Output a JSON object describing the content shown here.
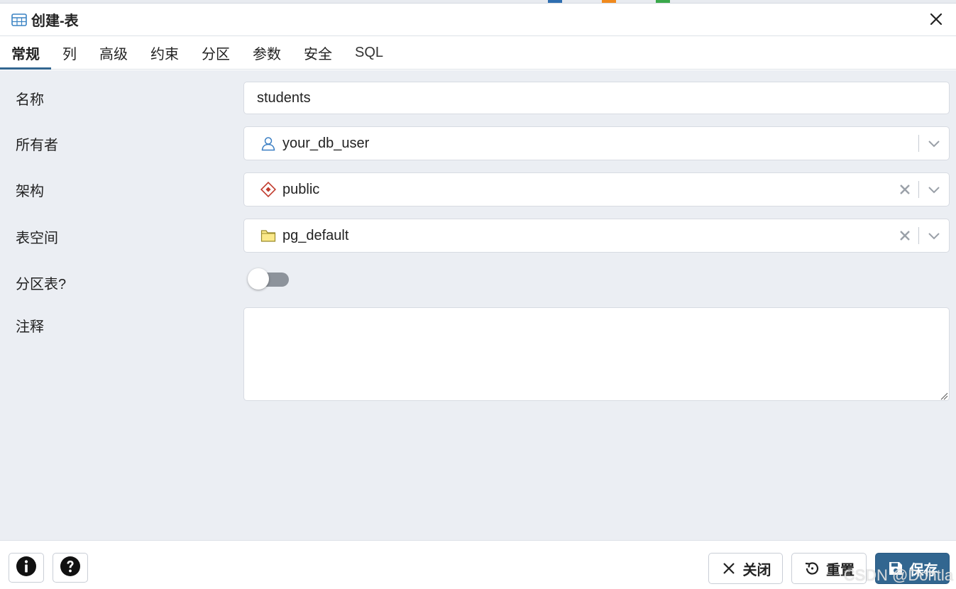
{
  "dialog": {
    "title": "创建-表",
    "close_icon": "close-icon"
  },
  "tabs": [
    {
      "label": "常规",
      "active": true
    },
    {
      "label": "列"
    },
    {
      "label": "高级"
    },
    {
      "label": "约束"
    },
    {
      "label": "分区"
    },
    {
      "label": "参数"
    },
    {
      "label": "安全"
    },
    {
      "label": "SQL"
    }
  ],
  "form": {
    "name": {
      "label": "名称",
      "value": "students"
    },
    "owner": {
      "label": "所有者",
      "value": "your_db_user",
      "icon": "user-icon"
    },
    "schema": {
      "label": "架构",
      "value": "public",
      "icon": "schema-icon"
    },
    "tablespace": {
      "label": "表空间",
      "value": "pg_default",
      "icon": "folder-icon"
    },
    "partitioned": {
      "label": "分区表?",
      "value": false
    },
    "comment": {
      "label": "注释",
      "value": ""
    }
  },
  "footer": {
    "info_icon": "info-icon",
    "help_icon": "help-icon",
    "close_label": "关闭",
    "reset_label": "重置",
    "save_label": "保存"
  },
  "colors": {
    "accent": "#326690",
    "content_bg": "#ebeef3"
  },
  "watermark": "CSDN @Dohtla"
}
